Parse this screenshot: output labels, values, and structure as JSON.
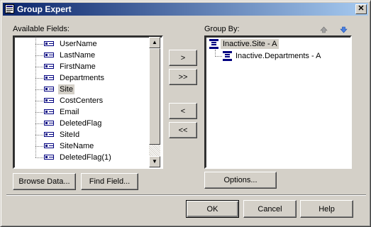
{
  "window": {
    "title": "Group Expert",
    "close_glyph": "✕"
  },
  "available": {
    "label": "Available Fields:",
    "fields": [
      "UserName",
      "LastName",
      "FirstName",
      "Departments",
      "Site",
      "CostCenters",
      "Email",
      "DeletedFlag",
      "SiteId",
      "SiteName",
      "DeletedFlag(1)"
    ],
    "selected_index": 4
  },
  "move_buttons": {
    "add": ">",
    "add_all": ">>",
    "remove": "<",
    "remove_all": "<<"
  },
  "group_by": {
    "label": "Group By:",
    "items": [
      "Inactive.Site - A",
      "Inactive.Departments - A"
    ],
    "up_icon": "up-arrow-icon",
    "down_icon": "down-arrow-icon"
  },
  "buttons": {
    "browse": "Browse Data...",
    "find": "Find Field...",
    "options": "Options...",
    "ok": "OK",
    "cancel": "Cancel",
    "help": "Help"
  },
  "colors": {
    "title_start": "#0a246a",
    "title_end": "#a6caf0",
    "face": "#d4d0c8",
    "icon_blue": "#000080"
  }
}
